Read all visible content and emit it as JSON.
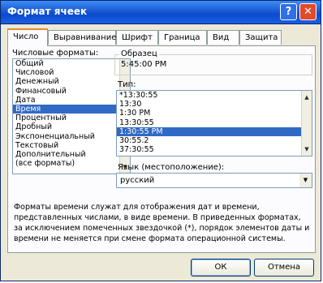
{
  "window": {
    "title": "Формат ячеек"
  },
  "tabs": [
    {
      "label": "Число",
      "active": true
    },
    {
      "label": "Выравнивание",
      "active": false
    },
    {
      "label": "Шрифт",
      "active": false
    },
    {
      "label": "Граница",
      "active": false
    },
    {
      "label": "Вид",
      "active": false
    },
    {
      "label": "Защита",
      "active": false
    }
  ],
  "formats": {
    "label": "Числовые форматы:",
    "items": [
      "Общий",
      "Числовой",
      "Денежный",
      "Финансовый",
      "Дата",
      "Время",
      "Процентный",
      "Дробный",
      "Экспоненциальный",
      "Текстовый",
      "Дополнительный",
      "(все форматы)"
    ],
    "selected_index": 5
  },
  "sample": {
    "label": "Образец",
    "value": "5:45:00 PM"
  },
  "type": {
    "label": "Тип:",
    "items": [
      "*13:30:55",
      "13:30",
      "1:30 PM",
      "13:30:55",
      "1:30:55 PM",
      "30:55.2",
      "37:30:55"
    ],
    "selected_index": 4
  },
  "locale": {
    "label": "Язык (местоположение):",
    "value": "русский"
  },
  "description": "Форматы времени служат для отображения дат и времени, представленных числами, в виде времени. В приведенных форматах, за исключением помеченных звездочкой (*), порядок элементов даты и времени не меняется при смене формата операционной системы.",
  "buttons": {
    "ok": "ОК",
    "cancel": "Отмена"
  }
}
